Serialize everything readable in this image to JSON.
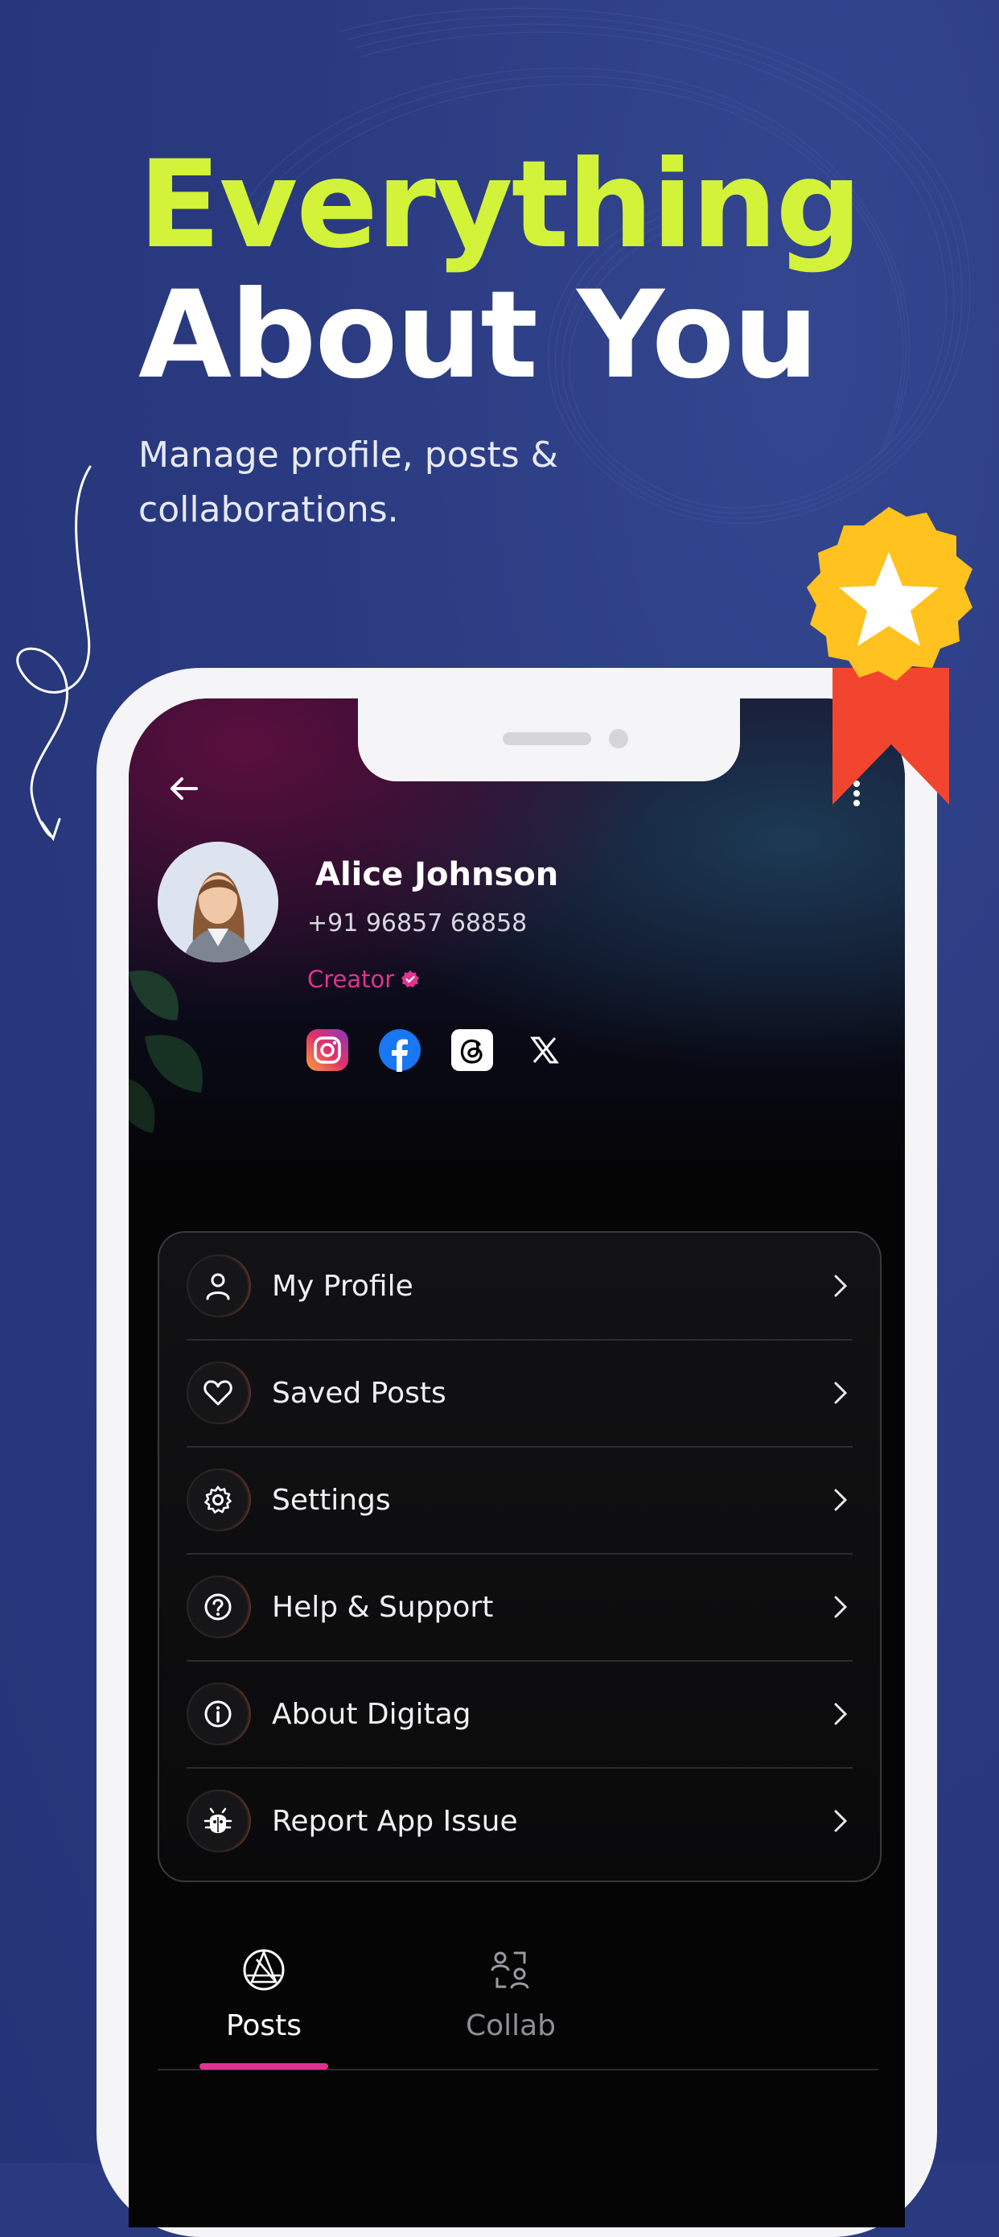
{
  "promo": {
    "headline_line1": "Everything",
    "headline_line2": "About You",
    "subtitle": "Manage profile, posts & collaborations."
  },
  "profile": {
    "name": "Alice Johnson",
    "phone": "+91 96857 68858",
    "role": "Creator",
    "socials": [
      "instagram-icon",
      "facebook-icon",
      "threads-icon",
      "x-icon"
    ]
  },
  "menu": {
    "items": [
      {
        "label": "My Profile",
        "icon": "user-icon"
      },
      {
        "label": "Saved Posts",
        "icon": "heart-icon"
      },
      {
        "label": "Settings",
        "icon": "gear-icon"
      },
      {
        "label": "Help & Support",
        "icon": "help-icon"
      },
      {
        "label": "About Digitag",
        "icon": "info-icon"
      },
      {
        "label": "Report App Issue",
        "icon": "bug-icon"
      }
    ]
  },
  "tabs": [
    {
      "label": "Posts",
      "active": true,
      "icon": "posts-icon"
    },
    {
      "label": "Collab",
      "active": false,
      "icon": "collab-icon"
    }
  ],
  "colors": {
    "accent_lime": "#d3f23a",
    "accent_pink": "#e0338f",
    "background": "#2a3a80"
  }
}
